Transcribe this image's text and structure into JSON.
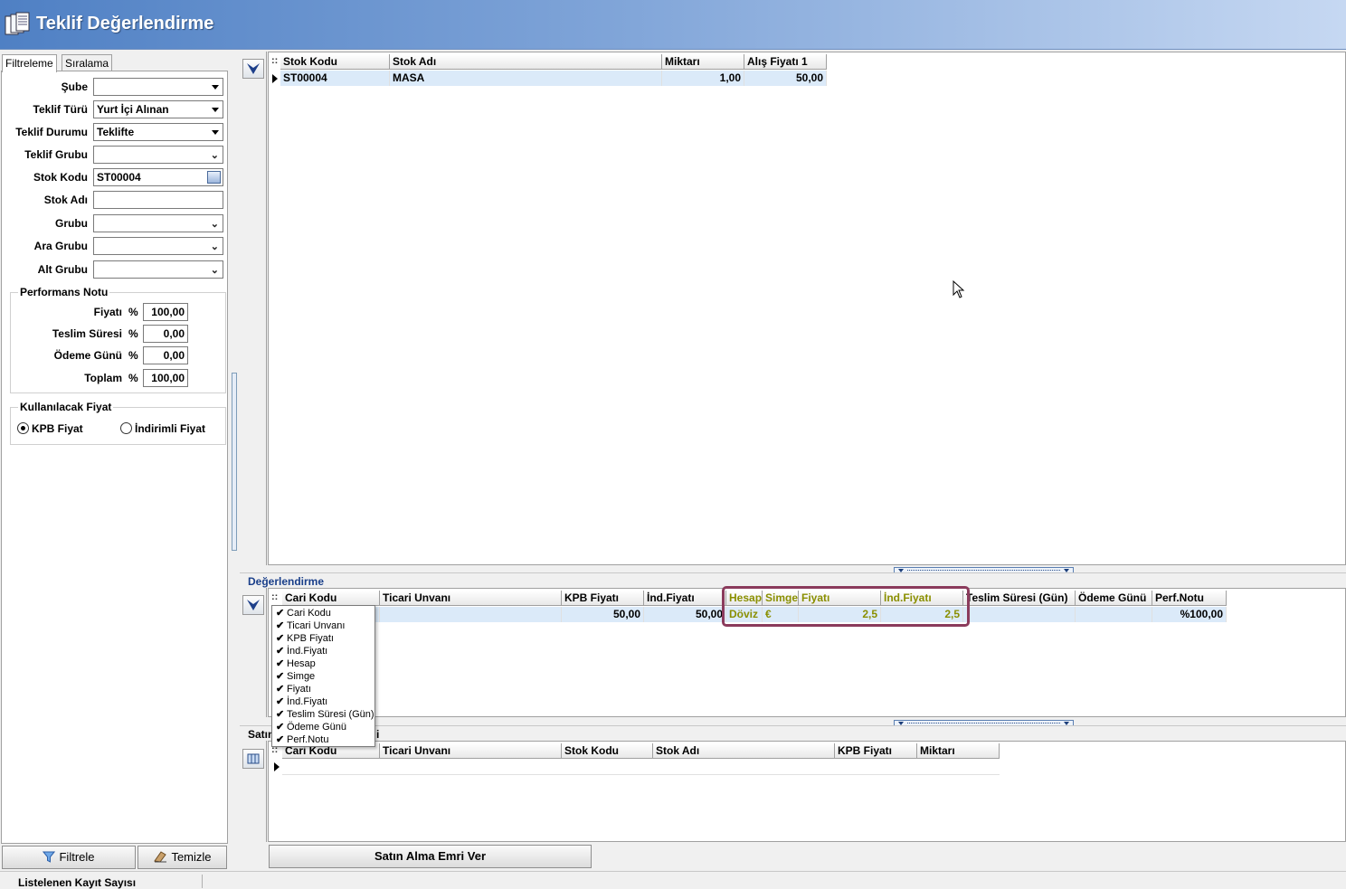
{
  "window": {
    "title": "Teklif Değerlendirme"
  },
  "tabs": [
    {
      "label": "Filtreleme"
    },
    {
      "label": "Sıralama"
    }
  ],
  "filters": {
    "sube": {
      "label": "Şube",
      "value": ""
    },
    "teklif_turu": {
      "label": "Teklif Türü",
      "value": "Yurt İçi Alınan"
    },
    "teklif_durumu": {
      "label": "Teklif Durumu",
      "value": "Teklifte"
    },
    "teklif_grubu": {
      "label": "Teklif Grubu",
      "value": ""
    },
    "stok_kodu": {
      "label": "Stok Kodu",
      "value": "ST00004"
    },
    "stok_adi": {
      "label": "Stok Adı",
      "value": ""
    },
    "grubu": {
      "label": "Grubu",
      "value": ""
    },
    "ara_grubu": {
      "label": "Ara Grubu",
      "value": ""
    },
    "alt_grubu": {
      "label": "Alt Grubu",
      "value": ""
    }
  },
  "performans": {
    "title": "Performans Notu",
    "pct": "%",
    "rows": [
      {
        "label": "Fiyatı",
        "value": "100,00"
      },
      {
        "label": "Teslim Süresi",
        "value": "0,00"
      },
      {
        "label": "Ödeme Günü",
        "value": "0,00"
      },
      {
        "label": "Toplam",
        "value": "100,00"
      }
    ]
  },
  "fiyat": {
    "title": "Kullanılacak Fiyat",
    "option1": "KPB Fiyat",
    "option2": "İndirimli Fiyat",
    "selected": "KPB Fiyat"
  },
  "buttons": {
    "filtrele": "Filtrele",
    "temizle": "Temizle",
    "satin_alma": "Satın Alma Emri Ver"
  },
  "status": {
    "text": "Listelenen Kayıt Sayısı"
  },
  "stock_grid": {
    "headers": [
      "Stok Kodu",
      "Stok Adı",
      "Miktarı",
      "Alış Fiyatı 1"
    ],
    "rows": [
      [
        "ST00004",
        "MASA",
        "1,00",
        "50,00"
      ]
    ]
  },
  "eval_section": {
    "title": "Değerlendirme"
  },
  "eval_grid": {
    "headers": [
      "Cari Kodu",
      "Ticari Unvanı",
      "KPB Fiyatı",
      "İnd.Fiyatı",
      "Hesap",
      "Simge",
      "Fiyatı",
      "İnd.Fiyatı",
      "Teslim Süresi (Gün)",
      "Ödeme Günü",
      "Perf.Notu"
    ],
    "row": [
      "",
      "",
      "50,00",
      "50,00",
      "Döviz",
      "€",
      "2,5",
      "2,5",
      "",
      "",
      "%100,00"
    ]
  },
  "column_menu": {
    "items": [
      "Cari Kodu",
      "Ticari Unvanı",
      "KPB Fiyatı",
      "İnd.Fiyatı",
      "Hesap",
      "Simge",
      "Fiyatı",
      "İnd.Fiyatı",
      "Teslim Süresi (Gün)",
      "Ödeme Günü",
      "Perf.Notu"
    ],
    "check": "✔"
  },
  "order_section": {
    "title_start": "Satın",
    "title_end": "i"
  },
  "order_grid": {
    "headers": [
      "Cari Kodu",
      "Ticari Unvanı",
      "Stok Kodu",
      "Stok Adı",
      "KPB Fiyatı",
      "Miktarı"
    ]
  },
  "grid_dots": "::",
  "colors": {
    "title_gradient_start": "#4f80c4",
    "selection": "#dbeaf9",
    "highlight_border": "#8b3b5c",
    "gold_text": "#8a8f00"
  }
}
